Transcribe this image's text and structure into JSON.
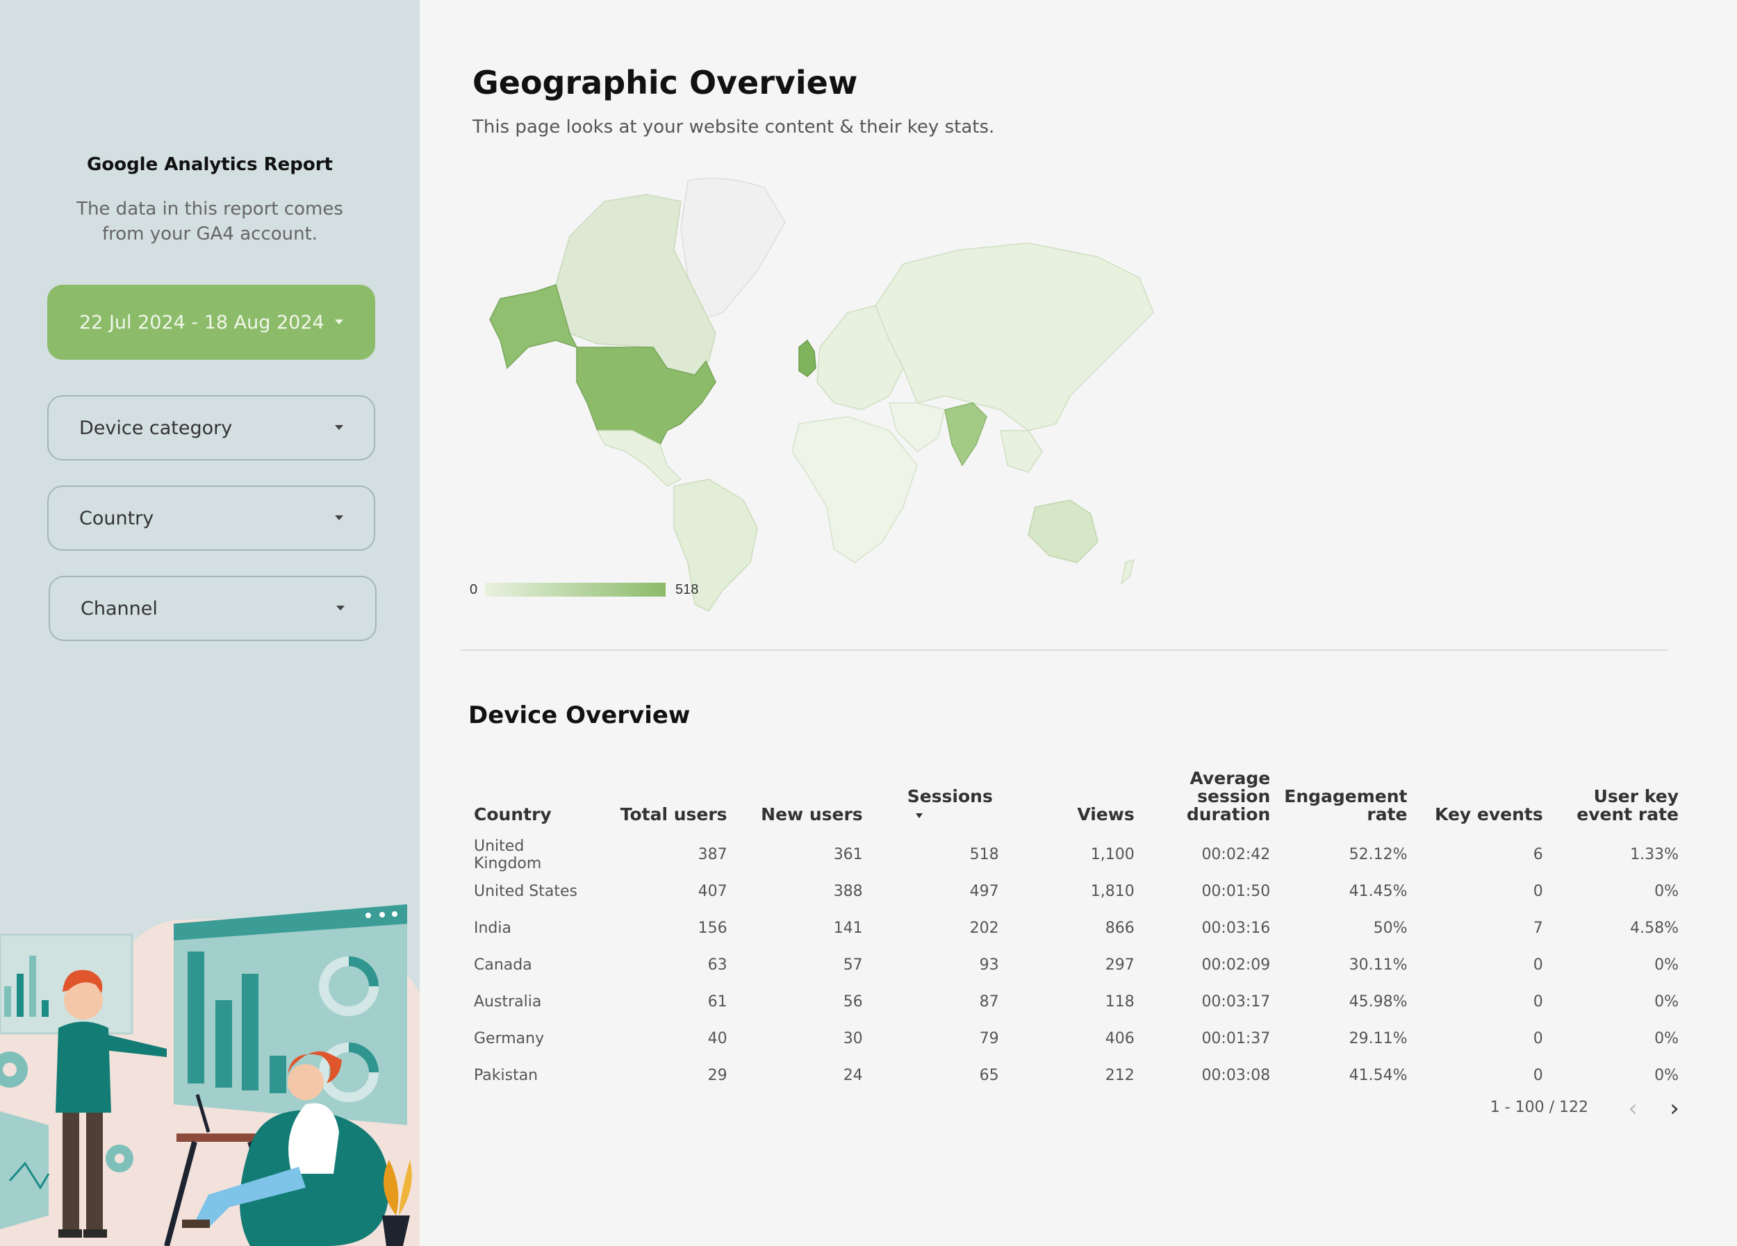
{
  "sidebar": {
    "title": "Google Analytics Report",
    "description": "The data in this report comes from your GA4 account.",
    "date_range": "22 Jul 2024 - 18 Aug 2024",
    "filters": [
      "Device category",
      "Country",
      "Channel"
    ]
  },
  "main": {
    "title": "Geographic Overview",
    "subtitle": "This page looks at your website content & their key stats.",
    "map": {
      "legend_min": "0",
      "legend_max": "518",
      "color_low": "#e8f1df",
      "color_high": "#8cbb6a",
      "highlighted": [
        "United Kingdom",
        "United States",
        "India",
        "Alaska"
      ]
    },
    "table_title": "Device Overview",
    "columns": [
      "Country",
      "Total users",
      "New users",
      "Sessions",
      "Views",
      "Average session duration",
      "Engagement rate",
      "Key events",
      "User key event rate"
    ],
    "rows": [
      [
        "United Kingdom",
        "387",
        "361",
        "518",
        "1,100",
        "00:02:42",
        "52.12%",
        "6",
        "1.33%"
      ],
      [
        "United States",
        "407",
        "388",
        "497",
        "1,810",
        "00:01:50",
        "41.45%",
        "0",
        "0%"
      ],
      [
        "India",
        "156",
        "141",
        "202",
        "866",
        "00:03:16",
        "50%",
        "7",
        "4.58%"
      ],
      [
        "Canada",
        "63",
        "57",
        "93",
        "297",
        "00:02:09",
        "30.11%",
        "0",
        "0%"
      ],
      [
        "Australia",
        "61",
        "56",
        "87",
        "118",
        "00:03:17",
        "45.98%",
        "0",
        "0%"
      ],
      [
        "Germany",
        "40",
        "30",
        "79",
        "406",
        "00:01:37",
        "29.11%",
        "0",
        "0%"
      ],
      [
        "Pakistan",
        "29",
        "24",
        "65",
        "212",
        "00:03:08",
        "41.54%",
        "0",
        "0%"
      ]
    ],
    "pagination": "1 - 100 / 122"
  }
}
